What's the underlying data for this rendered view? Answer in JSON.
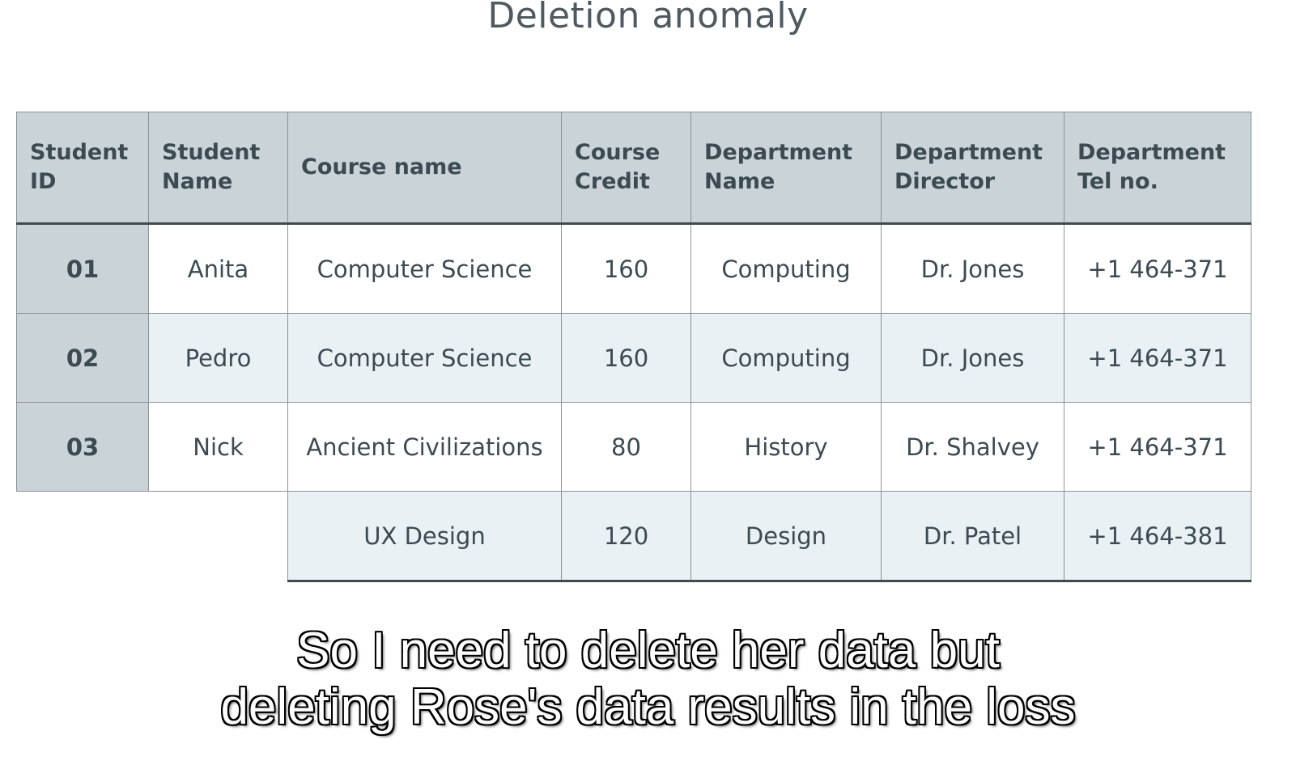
{
  "title": "Deletion anomaly",
  "table": {
    "headers": [
      [
        "Student",
        "ID"
      ],
      [
        "Student",
        "Name"
      ],
      [
        "Course name"
      ],
      [
        "Course",
        "Credit"
      ],
      [
        "Department",
        "Name"
      ],
      [
        "Department",
        "Director"
      ],
      [
        "Department",
        "Tel no."
      ]
    ],
    "rows": [
      {
        "student_id": "01",
        "student_name": "Anita",
        "course_name": "Computer Science",
        "course_credit": "160",
        "department_name": "Computing",
        "department_director": "Dr. Jones",
        "department_tel": "+1 464-371"
      },
      {
        "student_id": "02",
        "student_name": "Pedro",
        "course_name": "Computer Science",
        "course_credit": "160",
        "department_name": "Computing",
        "department_director": "Dr. Jones",
        "department_tel": "+1 464-371"
      },
      {
        "student_id": "03",
        "student_name": "Nick",
        "course_name": "Ancient Civilizations",
        "course_credit": "80",
        "department_name": "History",
        "department_director": "Dr. Shalvey",
        "department_tel": "+1 464-371"
      },
      {
        "student_id": "",
        "student_name": "",
        "course_name": "UX Design",
        "course_credit": "120",
        "department_name": "Design",
        "department_director": "Dr. Patel",
        "department_tel": "+1 464-381"
      }
    ]
  },
  "caption": {
    "line1": "So I need to delete her data but",
    "line2": "deleting Rose's data results in the loss"
  }
}
